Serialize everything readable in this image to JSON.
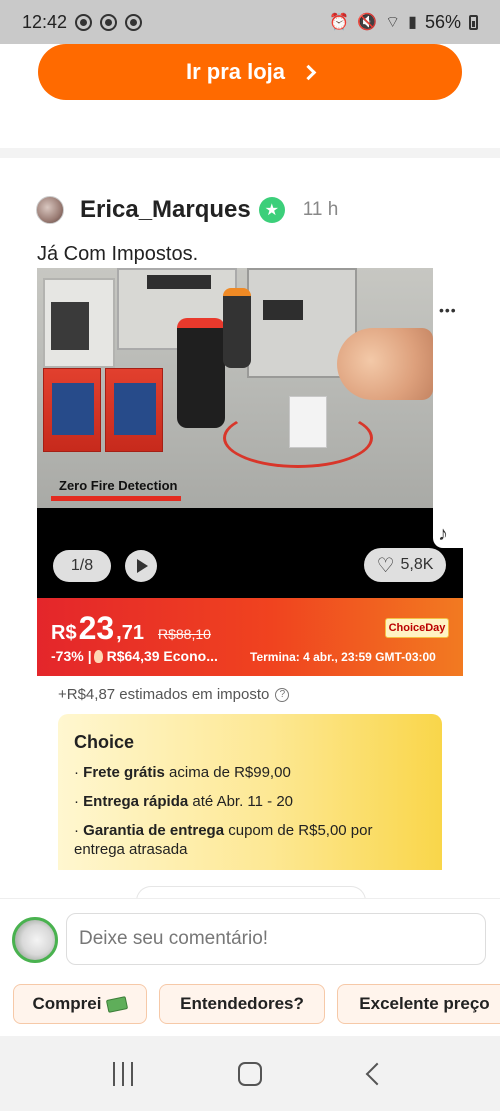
{
  "status_bar": {
    "time": "12:42",
    "battery": "56%",
    "icons": [
      "whatsapp-icon",
      "whatsapp-icon",
      "whatsapp-icon",
      "alarm-icon",
      "mute-icon",
      "wifi-icon",
      "signal-icon",
      "battery-icon"
    ]
  },
  "store_button": {
    "label": "Ir pra loja",
    "icon": "chevron-right-icon",
    "color": "#ff6a00"
  },
  "post": {
    "username": "Erica_Marques",
    "time": "11 h",
    "text": "Já Com Impostos.",
    "media": {
      "caption": "Zero Fire Detection",
      "counter": "1/8",
      "likes": "5,8K"
    }
  },
  "price": {
    "currency": "R$",
    "integer": "23",
    "decimal": ",71",
    "old_price": "R$88,10",
    "badge": "ChoiceDay",
    "discount": "-73%",
    "separator": "|",
    "economy": "R$64,39 Econo...",
    "ends": "Termina: 4 abr., 23:59 GMT-03:00",
    "banner_colors": [
      "#e4262b",
      "#f27a21"
    ]
  },
  "tax_line": "+R$4,87 estimados em imposto",
  "choice": {
    "title": "Choice",
    "items": [
      {
        "bold": "Frete grátis",
        "text": " acima de R$99,00"
      },
      {
        "bold": "Entrega rápida",
        "text": " até Abr. 11 - 20"
      },
      {
        "bold": "Garantia de entrega",
        "text": "  cupom de R$5,00 por entrega atrasada"
      }
    ]
  },
  "comment": {
    "placeholder": "Deixe seu comentário!"
  },
  "chips": [
    {
      "label": "Comprei"
    },
    {
      "label": "Entendedores?"
    },
    {
      "label": "Excelente preço"
    }
  ],
  "nav": [
    "recent-apps",
    "home",
    "back"
  ]
}
